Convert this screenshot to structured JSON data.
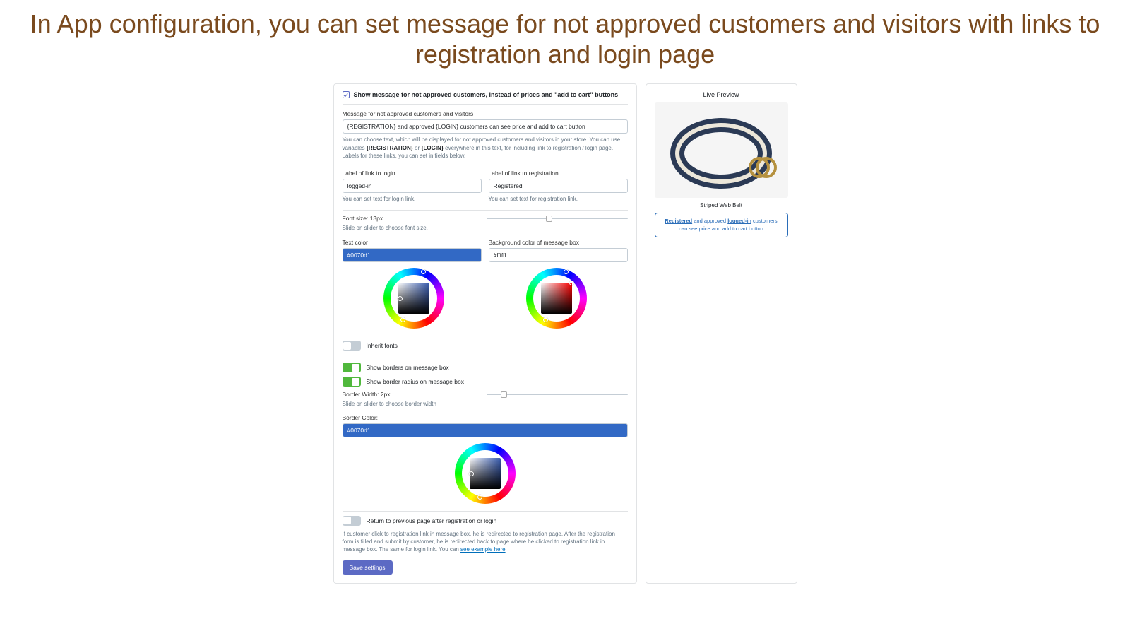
{
  "heading": "In App configuration, you can set message for not approved customers and visitors with links to registration and login page",
  "checkbox": {
    "checked": true,
    "label": "Show message for not approved customers, instead of prices and \"add to cart\" buttons"
  },
  "message_field": {
    "label": "Message for not approved customers and visitors",
    "value": "{REGISTRATION} and approved {LOGIN} customers can see price and add to cart button",
    "help_pre": "You can choose text, which will be displayed for not approved customers and visitors in your store. You can use variables ",
    "help_var1": "{REGISTRATION}",
    "help_mid": " or ",
    "help_var2": "{LOGIN}",
    "help_post": " everywhere in this text, for including link to registration / login page. Labels for these links, you can set in fields below."
  },
  "login_link": {
    "label": "Label of link to login",
    "value": "logged-in",
    "help": "You can set text for login link."
  },
  "registration_link": {
    "label": "Label of link to registration",
    "value": "Registered",
    "help": "You can set text for registration link."
  },
  "font_size": {
    "label": "Font size: 13px",
    "help": "Slide on slider to choose font size."
  },
  "text_color": {
    "label": "Text color",
    "value": "#0070d1",
    "bg": "#3269c5"
  },
  "bg_color": {
    "label": "Background color of message box",
    "value": "#ffffff",
    "bg": "#ffffff",
    "text_color": "#333"
  },
  "inherit_fonts": {
    "on": false,
    "label": "Inherit fonts"
  },
  "show_borders": {
    "on": true,
    "label": "Show borders on message box"
  },
  "show_border_radius": {
    "on": true,
    "label": "Show border radius on message box"
  },
  "border_width": {
    "label": "Border Width: 2px",
    "help": "Slide on slider to choose border width"
  },
  "border_color": {
    "label": "Border Color:",
    "value": "#0070d1",
    "bg": "#3269c5"
  },
  "return_prev": {
    "on": false,
    "label": "Return to previous page after registration or login",
    "help_pre": "If customer click to registration link in message box, he is redirected to registration page. After the registration form is filled and submit by customer, he is redirected back to page where he clicked to registration link in message box. The same for login link. You can ",
    "help_link": "see example here"
  },
  "save_label": "Save settings",
  "preview": {
    "title": "Live Preview",
    "product_name": "Striped Web Belt",
    "msg_pre": "",
    "reg_link": "Registered",
    "msg_mid": " and approved ",
    "login_link": "logged-in",
    "msg_post": " customers can see price and add to cart button"
  }
}
